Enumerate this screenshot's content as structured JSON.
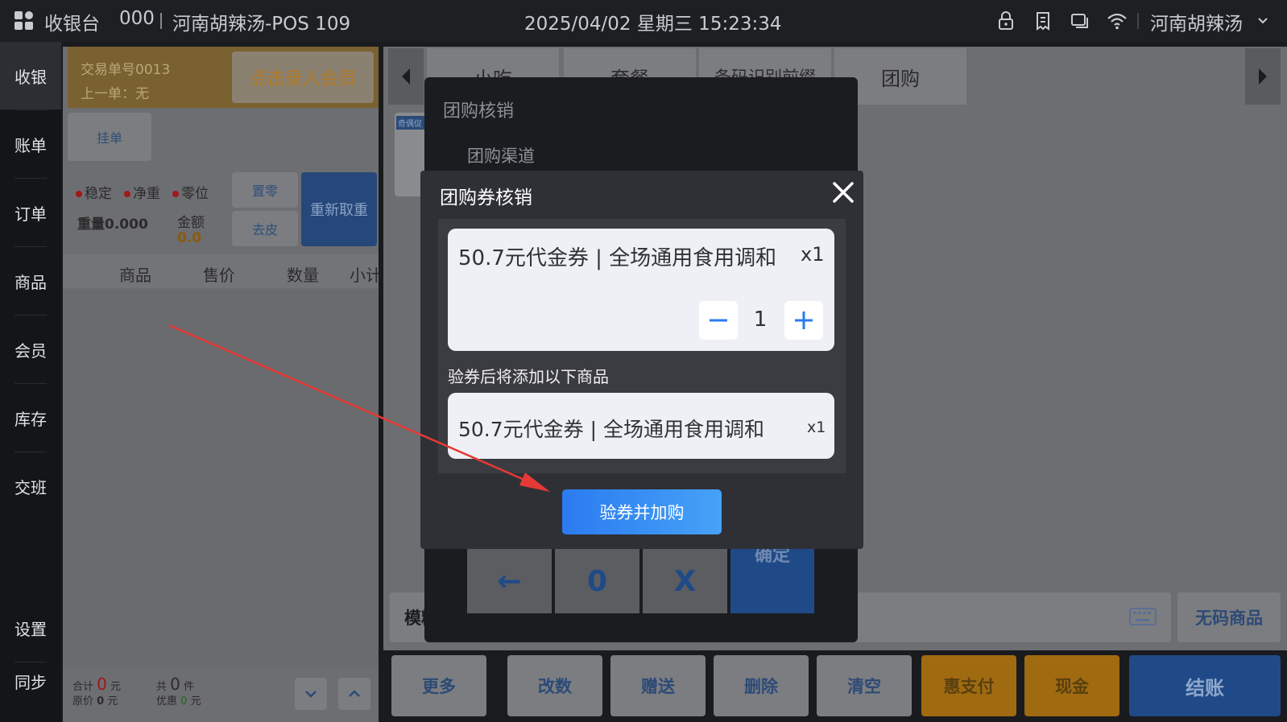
{
  "topbar": {
    "app_title": "收银台",
    "code": "000",
    "store_pos": "河南胡辣汤-POS 109",
    "datetime": "2025/04/02 星期三 15:23:34",
    "store_name": "河南胡辣汤"
  },
  "nav": {
    "items": [
      "收银",
      "账单",
      "订单",
      "商品",
      "会员",
      "库存",
      "交班"
    ],
    "settings": "设置",
    "sync": "同步"
  },
  "cart": {
    "order_no": "交易单号0013",
    "last_order": "上一单：无",
    "member_btn": "点击录入会员",
    "hold_btn": "挂单",
    "scale": {
      "stable": "稳定",
      "net": "净重",
      "zero": "零位",
      "weight": "重量0.000",
      "amount_label": "金额",
      "amount_value": "0.0",
      "zero_btn": "置零",
      "tare_btn": "去皮",
      "reweigh_btn": "重新取重"
    },
    "columns": [
      "商品",
      "售价",
      "数量",
      "小计"
    ],
    "footer": {
      "total_label": "合计",
      "total_value": "0",
      "yuan": "元",
      "orig_label": "原价",
      "orig_value": "0",
      "count_prefix": "共",
      "count_value": "0",
      "count_unit": "件",
      "discount_label": "优惠",
      "discount_value": "0"
    }
  },
  "right": {
    "tabs": [
      "小吃",
      "套餐",
      "条码识别前缀",
      "团购"
    ],
    "search_placeholder": "模糊",
    "nocode_btn": "无码商品",
    "bottom_buttons": [
      "更多",
      "改数",
      "赠送",
      "删除",
      "清空",
      "惠支付",
      "现金",
      "结账"
    ]
  },
  "under_dialog": {
    "title": "团购核销",
    "channel": "团购渠道",
    "keys": [
      "←",
      "0",
      "X",
      "确定"
    ],
    "thumb_label": "奇偶促"
  },
  "dialog": {
    "title": "团购券核销",
    "coupon_name": "50.7元代金券 | 全场通用食用调和",
    "coupon_qty_label": "x1",
    "quantity": "1",
    "section_label": "验券后将添加以下商品",
    "item_name": "50.7元代金券 | 全场通用食用调和",
    "item_qty_label": "x1",
    "confirm_btn": "验券并加购"
  },
  "colors": {
    "accent": "#2b7bf0",
    "annotation_arrow": "#e53935"
  }
}
